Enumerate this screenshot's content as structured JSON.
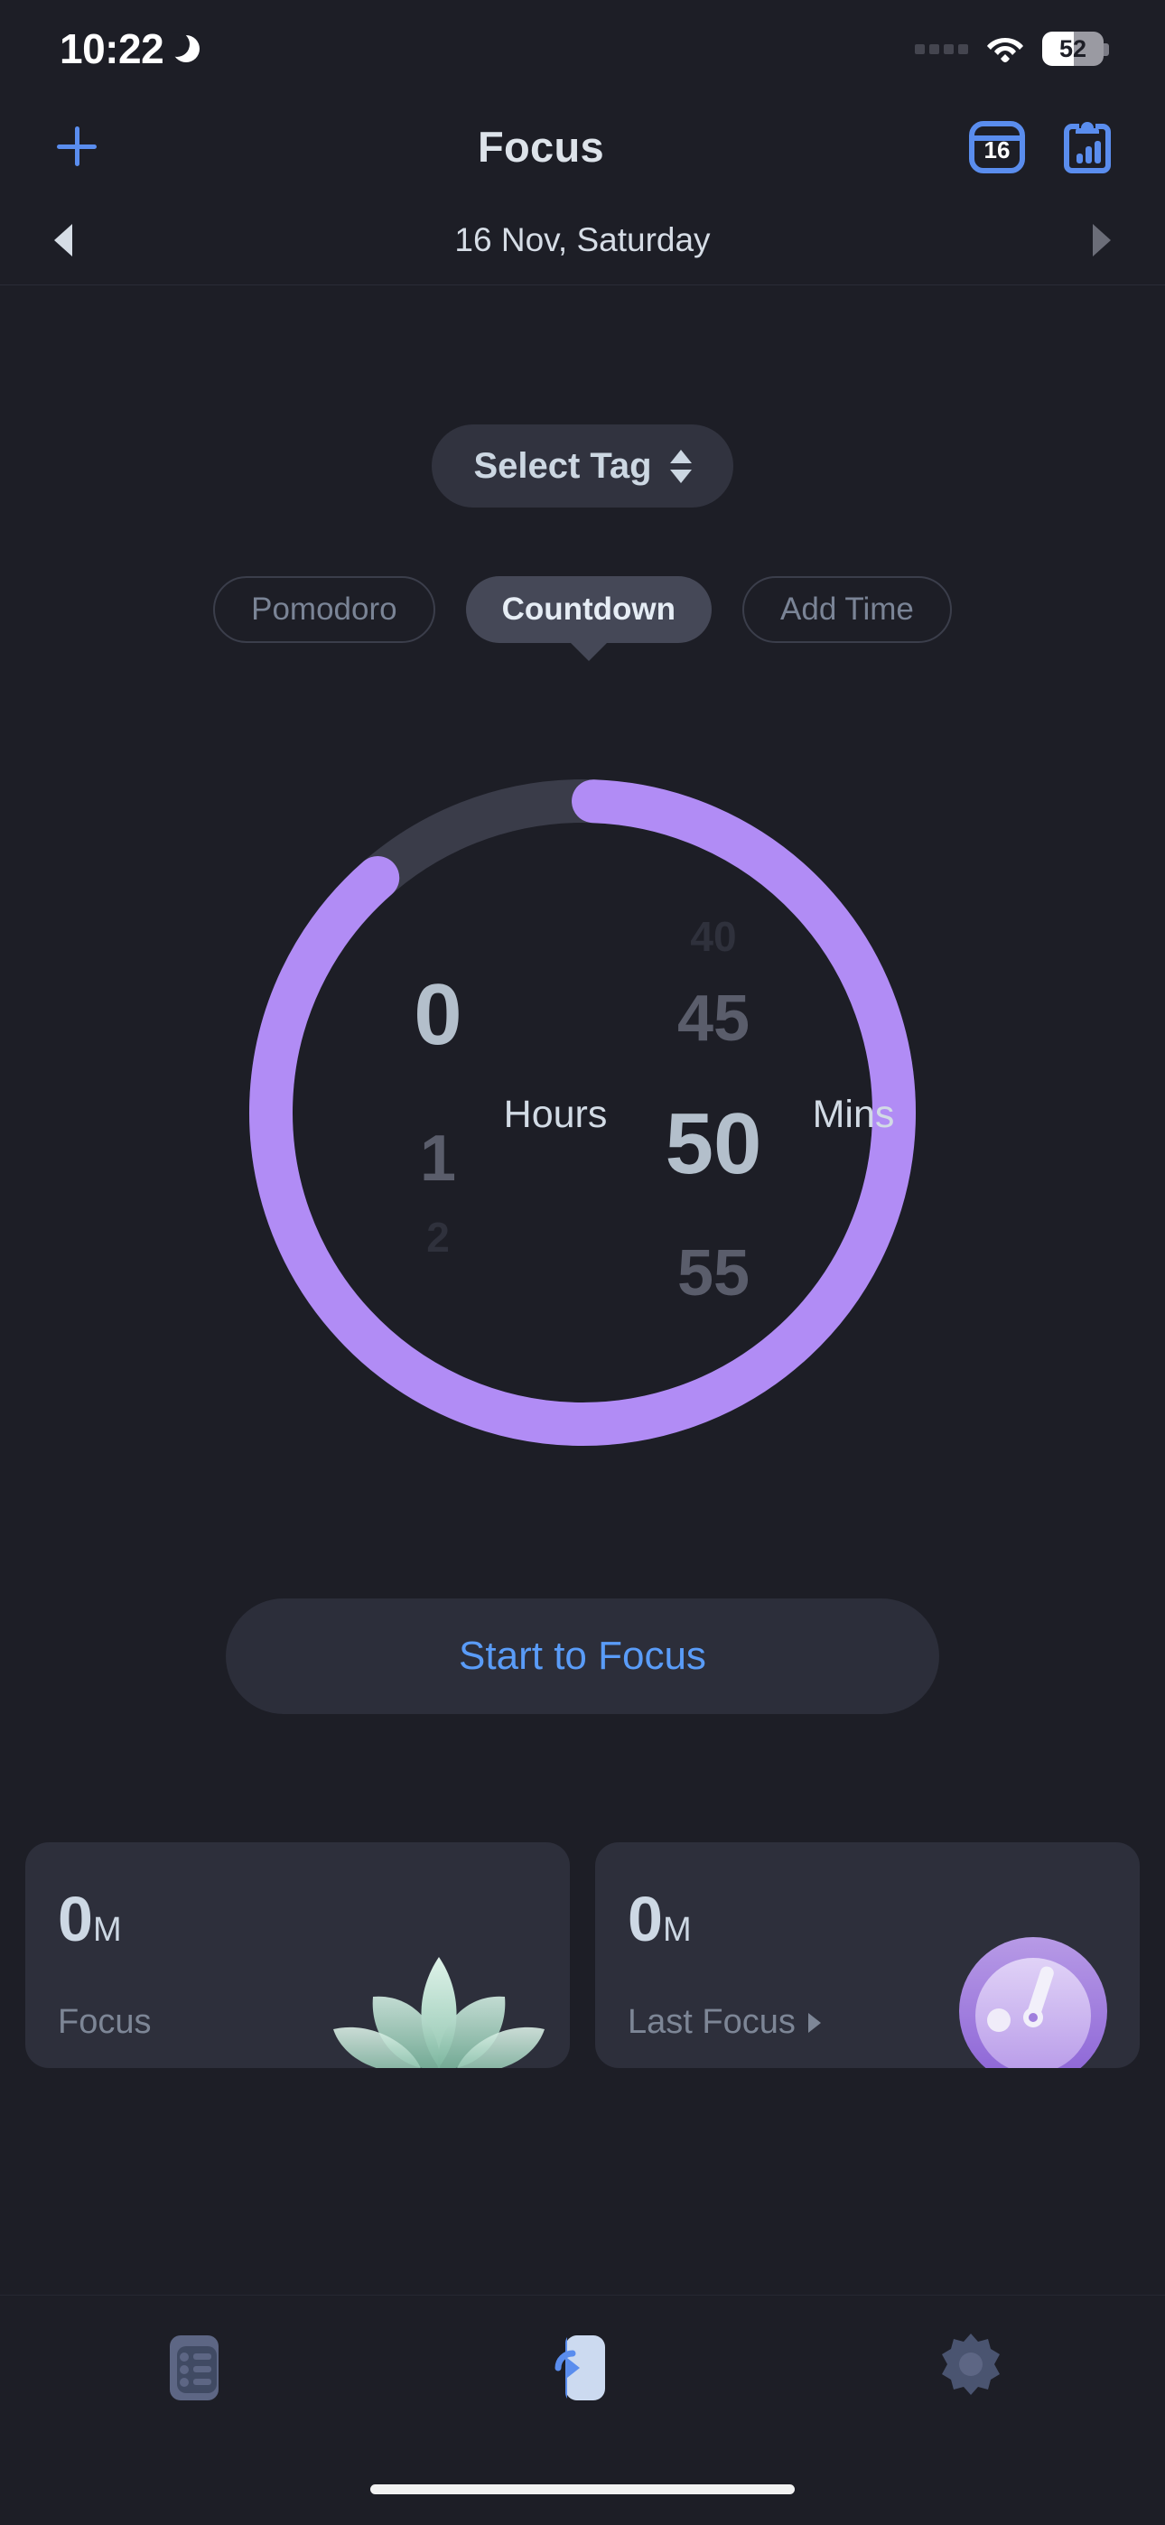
{
  "status_bar": {
    "time": "10:22",
    "dnd_icon": "crescent-moon-icon",
    "wifi_icon": "wifi-icon",
    "battery_percent": "52",
    "battery_level": 52
  },
  "nav_bar": {
    "add_icon": "plus-icon",
    "title": "Focus",
    "calendar_icon_label": "16",
    "calendar_icon": "calendar-icon",
    "stats_icon": "clipboard-chart-icon"
  },
  "date_nav": {
    "prev_icon": "chevron-left-icon",
    "label": "16 Nov, Saturday",
    "next_icon": "chevron-right-icon"
  },
  "tag_selector": {
    "label": "Select Tag",
    "icon": "up-down-chevron-icon"
  },
  "modes": [
    {
      "label": "Pomodoro",
      "active": false
    },
    {
      "label": "Countdown",
      "active": true
    },
    {
      "label": "Add Time",
      "active": false
    }
  ],
  "timer": {
    "hours_value": "0",
    "hours_unit": "Hours",
    "minutes_value": "50",
    "minutes_unit": "Mins",
    "hours_wheel": [
      "0",
      "1",
      "2"
    ],
    "minutes_wheel": [
      "40",
      "45",
      "50",
      "55"
    ],
    "progress_percent": 88,
    "track_color": "#3a3c49",
    "progress_color": "#b18cf5"
  },
  "start_button": {
    "label": "Start to Focus",
    "color": "#5a9cf8"
  },
  "stat_cards": [
    {
      "value": "0",
      "unit": "M",
      "label": "Focus",
      "has_caret": false,
      "art": "lotus-illustration"
    },
    {
      "value": "0",
      "unit": "M",
      "label": "Last Focus",
      "has_caret": true,
      "art": "clock-illustration"
    }
  ],
  "tab_bar": [
    {
      "name": "task",
      "icon": "task-list-icon",
      "active": false
    },
    {
      "name": "focus",
      "icon": "focus-timer-icon",
      "active": true
    },
    {
      "name": "settings",
      "icon": "gear-icon",
      "active": false
    }
  ]
}
